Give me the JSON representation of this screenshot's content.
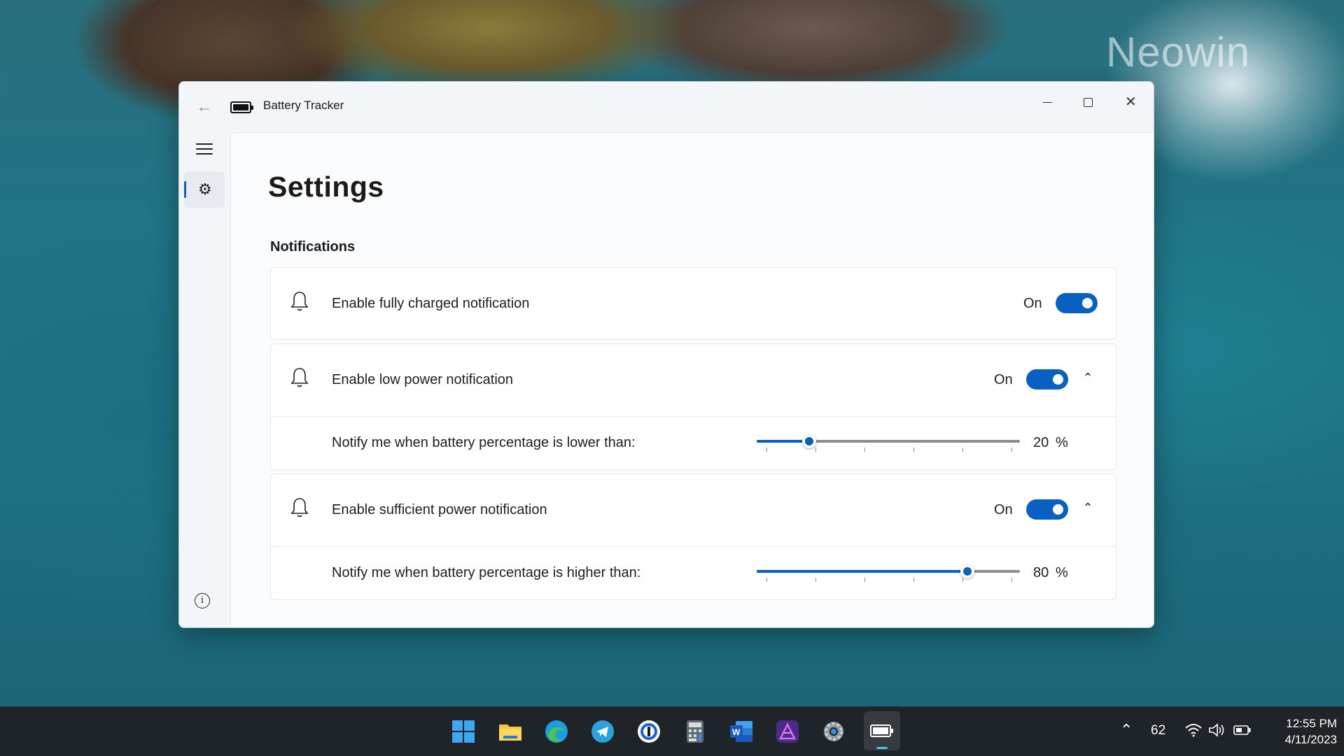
{
  "watermark": "Neowin",
  "window": {
    "title": "Battery Tracker",
    "back_icon": "back-arrow-icon",
    "controls": {
      "minimize": "minimize-icon",
      "maximize": "maximize-icon",
      "close": "close-icon"
    }
  },
  "sidebar": {
    "menu_icon": "hamburger-icon",
    "items": [
      {
        "icon": "gear-icon",
        "name": "settings",
        "selected": true
      }
    ],
    "footer_icon": "info-icon"
  },
  "page": {
    "title": "Settings",
    "section": "Notifications",
    "settings": [
      {
        "icon": "bell-icon",
        "label": "Enable fully charged notification",
        "state_label": "On",
        "enabled": true
      },
      {
        "icon": "bell-icon",
        "label": "Enable low power notification",
        "state_label": "On",
        "enabled": true,
        "expanded": true,
        "child": {
          "label": "Notify me when battery percentage is lower than:",
          "value": 20,
          "value_text": "20",
          "unit": "%",
          "min": 0,
          "max": 100
        }
      },
      {
        "icon": "bell-icon",
        "label": "Enable sufficient power notification",
        "state_label": "On",
        "enabled": true,
        "expanded": true,
        "child": {
          "label": "Notify me when battery percentage is higher than:",
          "value": 80,
          "value_text": "80",
          "unit": "%",
          "min": 0,
          "max": 100
        }
      }
    ]
  },
  "taskbar": {
    "apps": [
      "windows-start-icon",
      "file-explorer-icon",
      "edge-icon",
      "telegram-icon",
      "1password-icon",
      "calculator-icon",
      "word-icon",
      "affinity-photo-icon",
      "settings-icon",
      "battery-tracker-icon"
    ],
    "tray": {
      "chevron": "chevron-up-icon",
      "number": "62",
      "icons": [
        "wifi-icon",
        "volume-icon",
        "battery-icon"
      ]
    },
    "time": "12:55 PM",
    "date": "4/11/2023"
  },
  "colors": {
    "accent": "#0a5fc3",
    "taskbar": "#1f2428"
  }
}
